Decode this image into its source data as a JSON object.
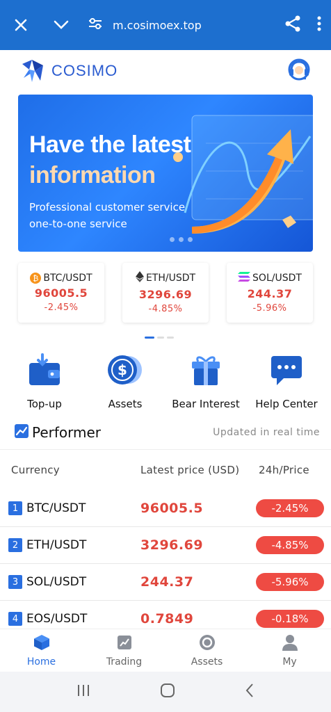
{
  "browser": {
    "url": "m.cosimoex.top",
    "close_icon": "close-icon",
    "menu_icon": "chevron-down-icon",
    "site_settings_icon": "tune-icon",
    "share_icon": "share-icon",
    "more_icon": "more-vert-icon"
  },
  "header": {
    "logo_text": "COSIMO",
    "support_icon": "headset-icon"
  },
  "banner": {
    "headline_line1": "Have the latest",
    "headline_line2": "information",
    "sub_line1": "Professional customer service",
    "sub_line2": "one-to-one service"
  },
  "tickers": [
    {
      "pair": "BTC/USDT",
      "price": "96005.5",
      "change": "-2.45%",
      "icon": "btc-icon",
      "color": "#f7931a"
    },
    {
      "pair": "ETH/USDT",
      "price": "3296.69",
      "change": "-4.85%",
      "icon": "eth-icon",
      "color": "#333333"
    },
    {
      "pair": "SOL/USDT",
      "price": "244.37",
      "change": "-5.96%",
      "icon": "sol-icon",
      "color": "#9945ff"
    }
  ],
  "actions": [
    {
      "label": "Top-up",
      "icon": "wallet-icon"
    },
    {
      "label": "Assets",
      "icon": "dollar-coin-icon"
    },
    {
      "label": "Bear Interest",
      "icon": "gift-icon"
    },
    {
      "label": "Help Center",
      "icon": "chat-bubble-icon"
    }
  ],
  "performer": {
    "title": "Performer",
    "note": "Updated in real time",
    "icon": "trend-chart-icon"
  },
  "table": {
    "headers": [
      "Currency",
      "Latest price (USD)",
      "24h/Price"
    ],
    "rows": [
      {
        "rank": "1",
        "pair": "BTC/USDT",
        "price": "96005.5",
        "change": "-2.45%"
      },
      {
        "rank": "2",
        "pair": "ETH/USDT",
        "price": "3296.69",
        "change": "-4.85%"
      },
      {
        "rank": "3",
        "pair": "SOL/USDT",
        "price": "244.37",
        "change": "-5.96%"
      },
      {
        "rank": "4",
        "pair": "EOS/USDT",
        "price": "0.7849",
        "change": "-0.18%"
      }
    ]
  },
  "bottom_nav": [
    {
      "label": "Home",
      "icon": "cube-icon",
      "active": true
    },
    {
      "label": "Trading",
      "icon": "chart-icon",
      "active": false
    },
    {
      "label": "Assets",
      "icon": "coin-icon",
      "active": false
    },
    {
      "label": "My",
      "icon": "user-icon",
      "active": false
    }
  ],
  "colors": {
    "brand": "#1d6fcf",
    "accent": "#2a6fe0",
    "down": "#e0463c"
  }
}
